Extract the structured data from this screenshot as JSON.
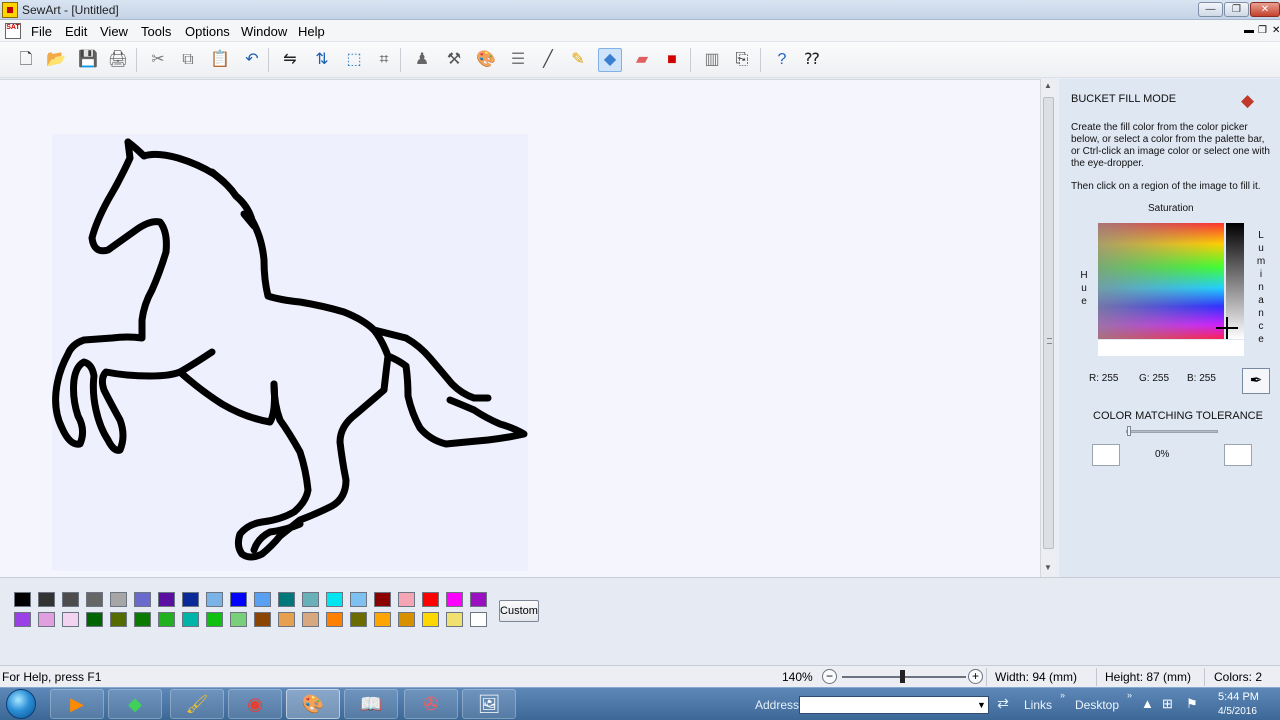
{
  "window": {
    "title": "SewArt - [Untitled]",
    "minimize": "—",
    "restore": "❐",
    "close": "✕"
  },
  "menu": {
    "logo": "SAT",
    "items": [
      "File",
      "Edit",
      "View",
      "Tools",
      "Options",
      "Window",
      "Help"
    ],
    "mdi_minimize": "▬",
    "mdi_restore": "❐",
    "mdi_close": "✕"
  },
  "toolbar": {
    "buttons": [
      {
        "name": "new-file-icon",
        "glyph": "🗋"
      },
      {
        "name": "open-folder-icon",
        "glyph": "📂"
      },
      {
        "name": "save-icon",
        "glyph": "💾"
      },
      {
        "name": "print-preview-icon",
        "glyph": "🖨"
      },
      {
        "name": "cut-icon",
        "glyph": "✂"
      },
      {
        "name": "copy-icon",
        "glyph": "⧉"
      },
      {
        "name": "paste-icon",
        "glyph": "📋"
      },
      {
        "name": "undo-icon",
        "glyph": "↶"
      },
      {
        "name": "flip-horizontal-icon",
        "glyph": "⇋"
      },
      {
        "name": "flip-vertical-icon",
        "glyph": "⇅"
      },
      {
        "name": "resize-icon",
        "glyph": "⬚"
      },
      {
        "name": "crop-icon",
        "glyph": "⌗"
      },
      {
        "name": "stamp-icon",
        "glyph": "♟"
      },
      {
        "name": "tools-icon",
        "glyph": "⚒"
      },
      {
        "name": "palette-icon",
        "glyph": "🎨"
      },
      {
        "name": "list-icon",
        "glyph": "☰"
      },
      {
        "name": "line-icon",
        "glyph": "╱"
      },
      {
        "name": "pencil-icon",
        "glyph": "✎"
      },
      {
        "name": "bucket-fill-icon",
        "glyph": "◆"
      },
      {
        "name": "eraser-icon",
        "glyph": "▰"
      },
      {
        "name": "color-replace-icon",
        "glyph": "■"
      },
      {
        "name": "frame-icon",
        "glyph": "▥"
      },
      {
        "name": "sew-icon",
        "glyph": "⎘"
      },
      {
        "name": "help-icon",
        "glyph": "?"
      },
      {
        "name": "context-help-icon",
        "glyph": "⁇"
      }
    ]
  },
  "panel": {
    "title": "BUCKET FILL MODE",
    "icon": "bucket-fill-icon",
    "paragraph1": "Create the fill color from the color picker below, or select a color from the palette bar, or Ctrl-click an image color or select one with the eye-dropper.",
    "paragraph2": "Then click on a region of the image to fill it.",
    "saturation_label": "Saturation",
    "hue_label": "H u e",
    "luminance_label": "L u m i n a n c e",
    "r": "R: 255",
    "g": "G: 255",
    "b": "B: 255",
    "tolerance_label": "COLOR MATCHING TOLERANCE",
    "tolerance_value": "0%",
    "tolerance_fraction": 0
  },
  "palette": {
    "row1": [
      "#000000",
      "#333333",
      "#4d4d4d",
      "#666666",
      "#a6a6a6",
      "#6a6acd",
      "#5a0fa0",
      "#0a2a9a",
      "#7ab4e6",
      "#0000ff",
      "#5aa0f0",
      "#00787a",
      "#6ab0b8",
      "#00e6f0",
      "#7ec0f0",
      "#8b0000",
      "#f4a6b4",
      "#ff0000",
      "#ff00ff",
      "#9a10c0"
    ],
    "row2": [
      "#9a40e6",
      "#e0a0e0",
      "#f2d4f0",
      "#006400",
      "#556b00",
      "#0a7a00",
      "#20b020",
      "#00b4a8",
      "#10c010",
      "#7ad07a",
      "#8b4500",
      "#e6a050",
      "#d8a880",
      "#ff8000",
      "#6b6b00",
      "#ffa500",
      "#d89000",
      "#ffd700",
      "#f0e070",
      "#ffffff"
    ],
    "custom_label": "Custom"
  },
  "status": {
    "help": "For Help, press F1",
    "zoom": "140%",
    "zoom_fraction": 0.5,
    "width": "Width: 94 (mm)",
    "height": "Height: 87 (mm)",
    "colors": "Colors: 2"
  },
  "taskbar": {
    "apps": [
      {
        "name": "media-player-icon",
        "glyph": "▶",
        "color": "#ff8a00"
      },
      {
        "name": "sims-icon",
        "glyph": "◆",
        "color": "#3fd15a"
      },
      {
        "name": "paint-icon",
        "glyph": "🖌",
        "color": "#f0c030"
      },
      {
        "name": "chrome-icon",
        "glyph": "◉",
        "color": "#e34133"
      },
      {
        "name": "sewart-icon",
        "glyph": "🎨",
        "color": "#f0d040"
      },
      {
        "name": "kindle-icon",
        "glyph": "📖",
        "color": "#ffffff"
      },
      {
        "name": "pinwheel-icon",
        "glyph": "✇",
        "color": "#ff5a5a"
      },
      {
        "name": "photo-app-icon",
        "glyph": "🖼",
        "color": "#ffffff"
      }
    ],
    "address_label": "Address",
    "links_label": "Links",
    "desktop_label": "Desktop",
    "time": "5:44 PM",
    "date": "4/5/2016"
  }
}
